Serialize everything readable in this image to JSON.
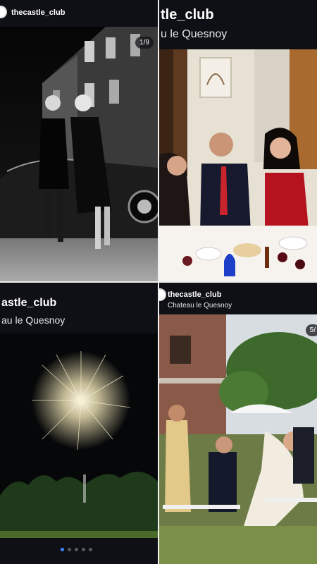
{
  "posts": [
    {
      "username": "thecastle_club",
      "counter": "1/9"
    },
    {
      "username": "tle_club",
      "location": "u le Quesnoy"
    },
    {
      "username": "astle_club",
      "location": "au le Quesnoy",
      "dots": 5,
      "active_dot": 0
    },
    {
      "username": "thecastle_club",
      "location": "Chateau le Quesnoy",
      "counter": "5/"
    }
  ],
  "icons": [
    "avatar-icon",
    "carousel-dot-icon"
  ]
}
